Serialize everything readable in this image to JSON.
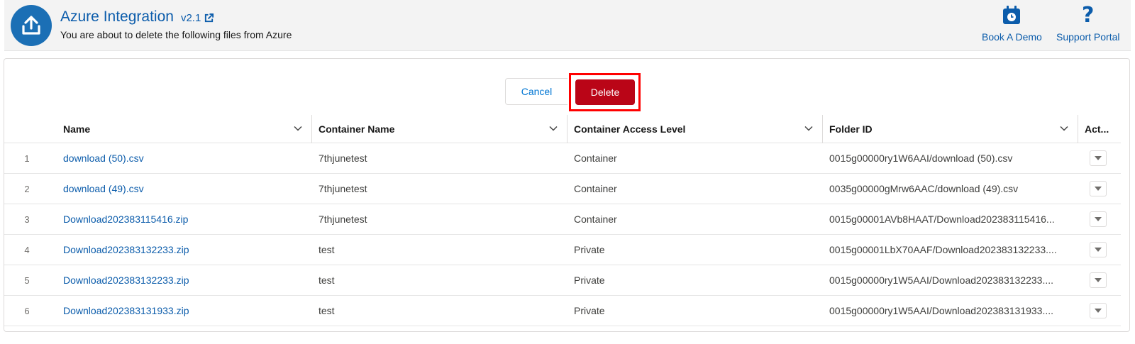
{
  "header": {
    "title": "Azure Integration",
    "version": "v2.1",
    "subtitle": "You are about to delete the following files from Azure",
    "book_demo_label": "Book A Demo",
    "support_label": "Support Portal"
  },
  "actions": {
    "cancel_label": "Cancel",
    "delete_label": "Delete"
  },
  "table": {
    "columns": {
      "name": "Name",
      "container": "Container Name",
      "access": "Container Access Level",
      "folder": "Folder ID",
      "actions": "Act..."
    },
    "rows": [
      {
        "num": "1",
        "name": "download (50).csv",
        "container": "7thjunetest",
        "access": "Container",
        "folder": "0015g00000ry1W6AAI/download (50).csv"
      },
      {
        "num": "2",
        "name": "download (49).csv",
        "container": "7thjunetest",
        "access": "Container",
        "folder": "0035g00000gMrw6AAC/download (49).csv"
      },
      {
        "num": "3",
        "name": "Download202383115416.zip",
        "container": "7thjunetest",
        "access": "Container",
        "folder": "0015g00001AVb8HAAT/Download202383115416..."
      },
      {
        "num": "4",
        "name": "Download202383132233.zip",
        "container": "test",
        "access": "Private",
        "folder": "0015g00001LbX70AAF/Download202383132233...."
      },
      {
        "num": "5",
        "name": "Download202383132233.zip",
        "container": "test",
        "access": "Private",
        "folder": "0015g00000ry1W5AAI/Download202383132233...."
      },
      {
        "num": "6",
        "name": "Download202383131933.zip",
        "container": "test",
        "access": "Private",
        "folder": "0015g00000ry1W5AAI/Download202383131933...."
      }
    ]
  },
  "icons": {
    "logo": "upload-icon",
    "version_link": "external-link-icon",
    "book_demo": "calendar-clock-icon",
    "support": "question-mark-icon",
    "column_menu": "chevron-down-icon",
    "row_action": "caret-down-icon"
  },
  "colors": {
    "brand": "#0b5cab",
    "delete": "#ba0517",
    "highlight": "#ff0000"
  }
}
